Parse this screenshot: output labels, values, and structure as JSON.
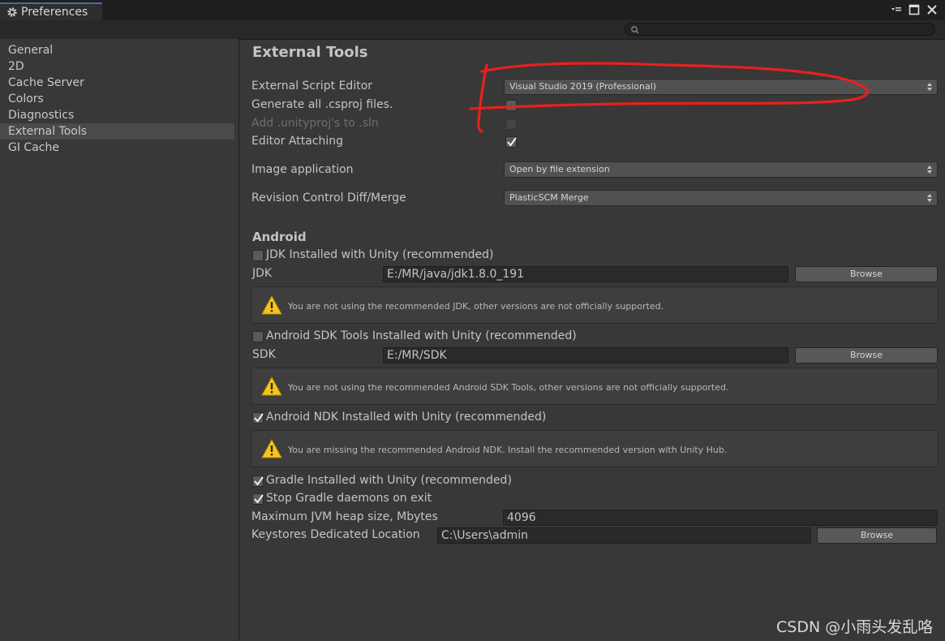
{
  "window": {
    "tab_title": "Preferences",
    "title_icon": "gear-icon",
    "controls": [
      "dropdown-menu-icon",
      "maximize-icon",
      "close-icon"
    ]
  },
  "search": {
    "placeholder": "",
    "icon": "search-icon"
  },
  "sidebar": {
    "items": [
      {
        "label": "General"
      },
      {
        "label": "2D"
      },
      {
        "label": "Cache Server"
      },
      {
        "label": "Colors"
      },
      {
        "label": "Diagnostics"
      },
      {
        "label": "External Tools",
        "active": true
      },
      {
        "label": "GI Cache"
      }
    ]
  },
  "main": {
    "title": "External Tools",
    "external_script_editor": {
      "label": "External Script Editor",
      "value": "Visual Studio 2019 (Professional)"
    },
    "generate_csproj": {
      "label": "Generate all .csproj files.",
      "checked": false
    },
    "add_unityproj": {
      "label": "Add .unityproj's to .sln",
      "checked": false,
      "disabled": true
    },
    "editor_attaching": {
      "label": "Editor Attaching",
      "checked": true
    },
    "image_application": {
      "label": "Image application",
      "value": "Open by file extension"
    },
    "revision_control": {
      "label": "Revision Control Diff/Merge",
      "value": "PlasticSCM Merge"
    },
    "android": {
      "title": "Android",
      "jdk_installed": {
        "label": "JDK Installed with Unity (recommended)",
        "checked": false
      },
      "jdk": {
        "label": "JDK",
        "value": "E:/MR/java/jdk1.8.0_191",
        "button": "Browse"
      },
      "jdk_warning": "You are not using the recommended JDK, other versions are not officially supported.",
      "sdk_installed": {
        "label": "Android SDK Tools Installed with Unity (recommended)",
        "checked": false
      },
      "sdk": {
        "label": "SDK",
        "value": "E:/MR/SDK",
        "button": "Browse"
      },
      "sdk_warning": "You are not using the recommended Android SDK Tools, other versions are not officially supported.",
      "ndk_installed": {
        "label": "Android NDK Installed with Unity (recommended)",
        "checked": true
      },
      "ndk_warning": "You are missing the recommended Android NDK. Install the recommended version with Unity Hub.",
      "gradle_installed": {
        "label": "Gradle Installed with Unity (recommended)",
        "checked": true
      },
      "stop_gradle": {
        "label": "Stop Gradle daemons on exit",
        "checked": true
      },
      "jvm_heap": {
        "label": "Maximum JVM heap size, Mbytes",
        "value": "4096"
      },
      "keystores": {
        "label": "Keystores Dedicated Location",
        "value": "C:\\Users\\admin",
        "button": "Browse"
      }
    }
  },
  "annotation": {
    "color": "#e8201e",
    "shape": "hand-drawn-circle"
  },
  "watermark": "CSDN @小雨头发乱咯"
}
